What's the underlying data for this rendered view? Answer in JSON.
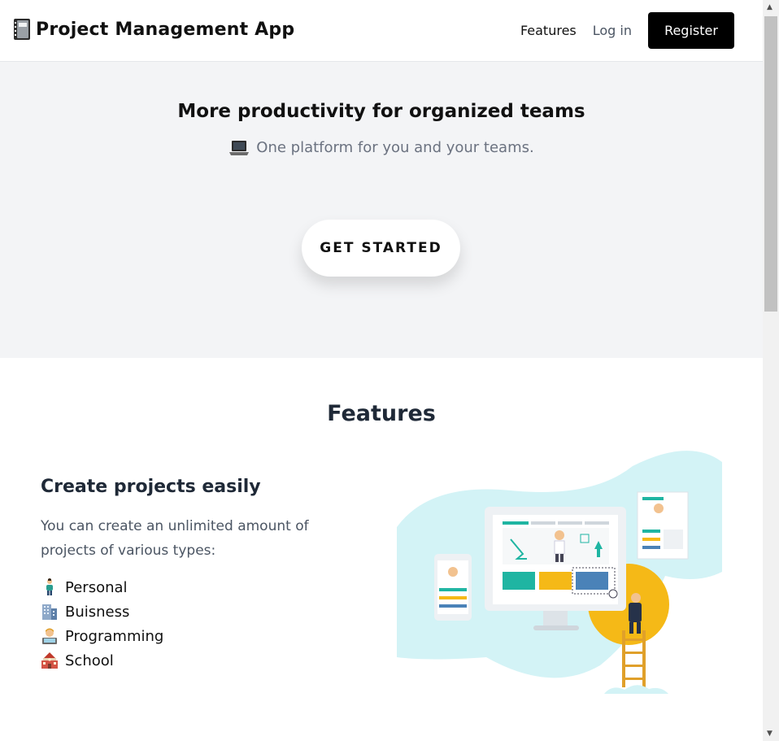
{
  "header": {
    "brand_title": "Project Management App",
    "brand_icon": "notebook-icon",
    "nav": {
      "features_label": "Features",
      "login_label": "Log in",
      "register_label": "Register"
    }
  },
  "hero": {
    "title": "More productivity for organized teams",
    "subtitle": "One platform for you and your teams.",
    "subtitle_icon": "laptop-icon",
    "cta_label": "GET STARTED"
  },
  "features": {
    "section_title": "Features",
    "items": [
      {
        "heading": "Create projects easily",
        "description": "You can create an unlimited amount of projects of various types:",
        "list": [
          {
            "label": "Personal",
            "icon": "person-icon"
          },
          {
            "label": "Buisness",
            "icon": "office-building-icon"
          },
          {
            "label": "Programming",
            "icon": "technologist-icon"
          },
          {
            "label": "School",
            "icon": "school-icon"
          }
        ],
        "illustration": "team-dashboard-illustration"
      }
    ]
  },
  "colors": {
    "hero_bg": "#f3f4f6",
    "primary_button": "#000000",
    "illustration_blob": "#d3f3f6",
    "accent_yellow": "#f5b917",
    "accent_teal": "#1fb5a2",
    "accent_blue": "#4a82b8"
  }
}
